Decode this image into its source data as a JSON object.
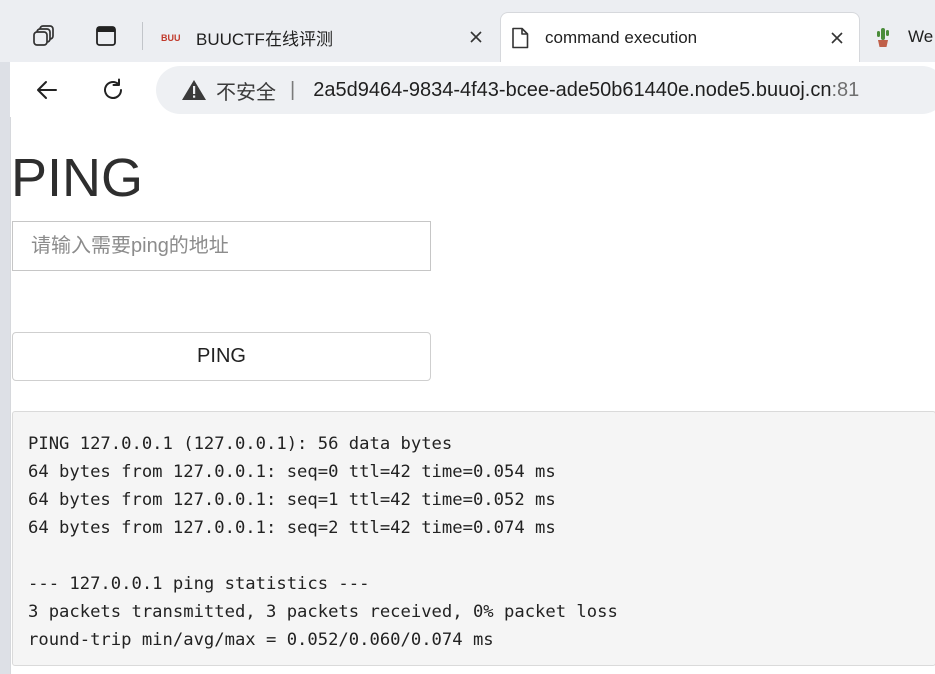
{
  "browser": {
    "tabs": [
      {
        "title": "BUUCTF在线评测",
        "favicon": "buuctf-logo-icon",
        "active": false
      },
      {
        "title": "command execution",
        "favicon": "document-icon",
        "active": true
      },
      {
        "title": "We",
        "favicon": "cactus-icon",
        "active": false
      }
    ],
    "security_label": "不安全",
    "url_host": "2a5d9464-9834-4f43-bcee-ade50b61440e.node5.buuoj.cn",
    "url_port": ":81"
  },
  "page": {
    "title": "PING",
    "input_placeholder": "请输入需要ping的地址",
    "button_label": "PING",
    "output_lines": [
      "PING 127.0.0.1 (127.0.0.1): 56 data bytes",
      "64 bytes from 127.0.0.1: seq=0 ttl=42 time=0.054 ms",
      "64 bytes from 127.0.0.1: seq=1 ttl=42 time=0.052 ms",
      "64 bytes from 127.0.0.1: seq=2 ttl=42 time=0.074 ms",
      "",
      "--- 127.0.0.1 ping statistics ---",
      "3 packets transmitted, 3 packets received, 0% packet loss",
      "round-trip min/avg/max = 0.052/0.060/0.074 ms"
    ]
  }
}
